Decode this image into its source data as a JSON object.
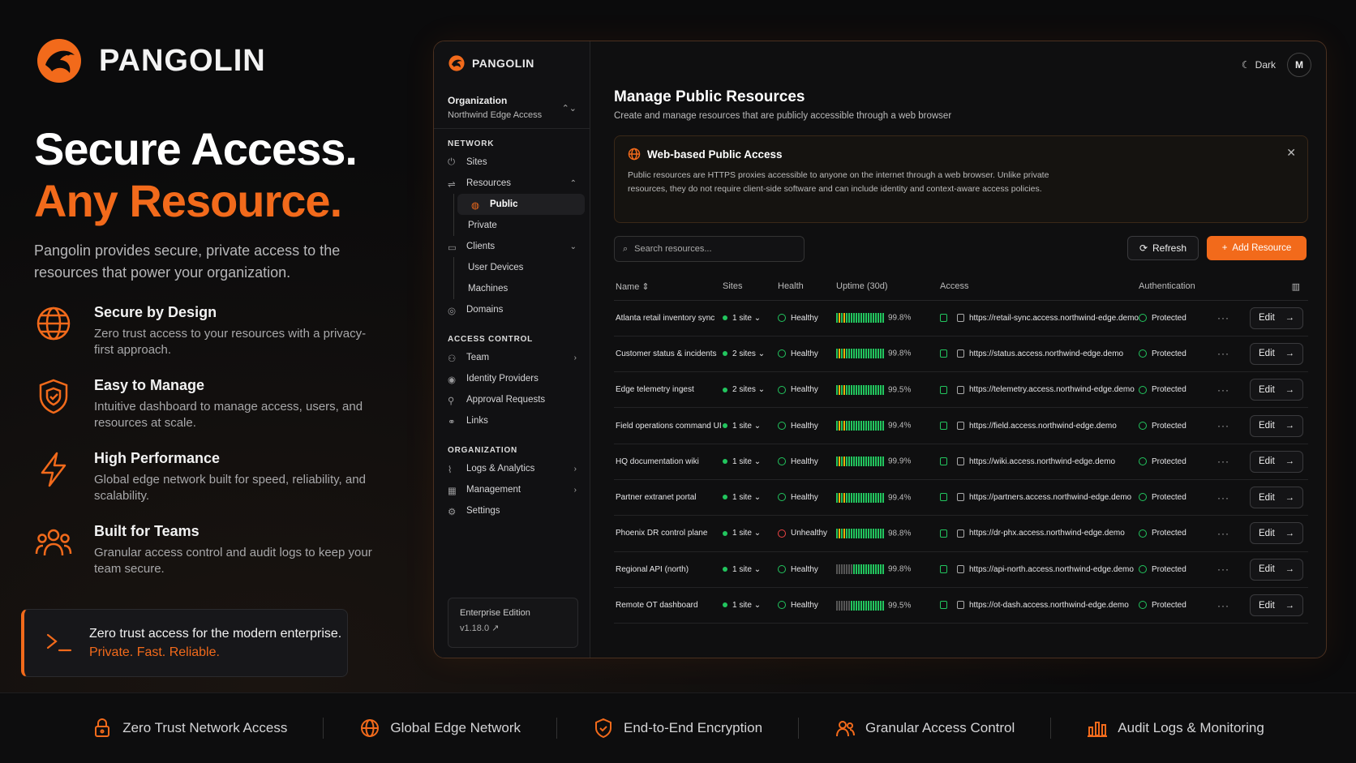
{
  "brand": {
    "name": "PANGOLIN"
  },
  "hero": {
    "line1": "Secure Access.",
    "line2": "Any Resource.",
    "desc": "Pangolin provides secure, private access to the resources that power your organization."
  },
  "features": [
    {
      "icon": "globe-icon",
      "title": "Secure by Design",
      "desc": "Zero trust access to your resources with a privacy-first approach."
    },
    {
      "icon": "shield-icon",
      "title": "Easy to Manage",
      "desc": "Intuitive dashboard to manage access, users, and resources at scale."
    },
    {
      "icon": "bolt-icon",
      "title": "High Performance",
      "desc": "Global edge network built for speed, reliability, and scalability."
    },
    {
      "icon": "team-icon",
      "title": "Built for Teams",
      "desc": "Granular access control and audit logs to keep your team secure."
    }
  ],
  "cta": {
    "line1": "Zero trust access for the modern enterprise.",
    "line2": "Private. Fast. Reliable."
  },
  "bottom": [
    {
      "icon": "lock-icon",
      "label": "Zero Trust Network Access"
    },
    {
      "icon": "globe-icon",
      "label": "Global Edge Network"
    },
    {
      "icon": "shield-icon",
      "label": "End-to-End Encryption"
    },
    {
      "icon": "team-icon",
      "label": "Granular Access Control"
    },
    {
      "icon": "chart-icon",
      "label": "Audit Logs & Monitoring"
    }
  ],
  "sidebar": {
    "logo": "PANGOLIN",
    "org_label": "Organization",
    "org_name": "Northwind Edge Access",
    "network": "NETWORK",
    "sites": "Sites",
    "resources": "Resources",
    "public": "Public",
    "private": "Private",
    "clients": "Clients",
    "user_devices": "User Devices",
    "machines": "Machines",
    "domains": "Domains",
    "access_control": "ACCESS CONTROL",
    "team": "Team",
    "idp": "Identity Providers",
    "approvals": "Approval Requests",
    "links": "Links",
    "organization": "ORGANIZATION",
    "logs": "Logs & Analytics",
    "management": "Management",
    "settings": "Settings",
    "edition": "Enterprise Edition",
    "version": "v1.18.0"
  },
  "topbar": {
    "theme": "Dark",
    "avatar": "M"
  },
  "main": {
    "title": "Manage Public Resources",
    "subtitle": "Create and manage resources that are publicly accessible through a web browser",
    "banner_title": "Web-based Public Access",
    "banner_desc": "Public resources are HTTPS proxies accessible to anyone on the internet through a web browser. Unlike private resources, they do not require client-side software and can include identity and context-aware access policies.",
    "search_placeholder": "Search resources...",
    "refresh": "Refresh",
    "add": "Add Resource"
  },
  "table": {
    "headers": {
      "name": "Name",
      "sites": "Sites",
      "health": "Health",
      "uptime": "Uptime (30d)",
      "access": "Access",
      "auth": "Authentication"
    },
    "rows": [
      {
        "name": "Atlanta retail inventory sync",
        "sites": "1 site",
        "health": "Healthy",
        "uptime": "99.8%",
        "url": "https://retail-sync.access.northwind-edge.demo",
        "auth": "Protected",
        "edit": "Edit"
      },
      {
        "name": "Customer status & incidents",
        "sites": "2 sites",
        "health": "Healthy",
        "uptime": "99.8%",
        "url": "https://status.access.northwind-edge.demo",
        "auth": "Protected",
        "edit": "Edit"
      },
      {
        "name": "Edge telemetry ingest",
        "sites": "2 sites",
        "health": "Healthy",
        "uptime": "99.5%",
        "url": "https://telemetry.access.northwind-edge.demo",
        "auth": "Protected",
        "edit": "Edit"
      },
      {
        "name": "Field operations command UI",
        "sites": "1 site",
        "health": "Healthy",
        "uptime": "99.4%",
        "url": "https://field.access.northwind-edge.demo",
        "auth": "Protected",
        "edit": "Edit"
      },
      {
        "name": "HQ documentation wiki",
        "sites": "1 site",
        "health": "Healthy",
        "uptime": "99.9%",
        "url": "https://wiki.access.northwind-edge.demo",
        "auth": "Protected",
        "edit": "Edit"
      },
      {
        "name": "Partner extranet portal",
        "sites": "1 site",
        "health": "Healthy",
        "uptime": "99.4%",
        "url": "https://partners.access.northwind-edge.demo",
        "auth": "Protected",
        "edit": "Edit"
      },
      {
        "name": "Phoenix DR control plane",
        "sites": "1 site",
        "health": "Unhealthy",
        "uptime": "98.8%",
        "url": "https://dr-phx.access.northwind-edge.demo",
        "auth": "Protected",
        "edit": "Edit"
      },
      {
        "name": "Regional API (north)",
        "sites": "1 site",
        "health": "Healthy",
        "uptime": "99.8%",
        "url": "https://api-north.access.northwind-edge.demo",
        "auth": "Protected",
        "edit": "Edit"
      },
      {
        "name": "Remote OT dashboard",
        "sites": "1 site",
        "health": "Healthy",
        "uptime": "99.5%",
        "url": "https://ot-dash.access.northwind-edge.demo",
        "auth": "Protected",
        "edit": "Edit"
      }
    ]
  },
  "colors": {
    "accent": "#f26a1b",
    "healthy": "#22c55e",
    "unhealthy": "#ef4444"
  }
}
